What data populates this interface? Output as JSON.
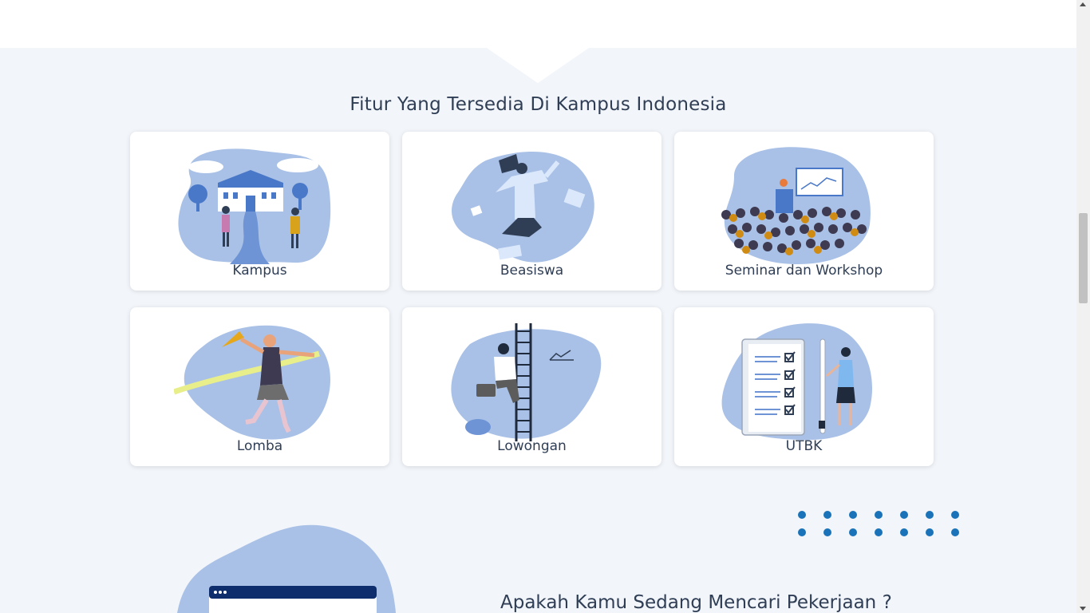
{
  "section": {
    "title": "Fitur Yang Tersedia Di Kampus Indonesia"
  },
  "features": [
    {
      "label": "Kampus",
      "icon": "campus-illustration"
    },
    {
      "label": "Beasiswa",
      "icon": "scholarship-illustration"
    },
    {
      "label": "Seminar dan Workshop",
      "icon": "seminar-illustration"
    },
    {
      "label": "Lomba",
      "icon": "competition-illustration"
    },
    {
      "label": "Lowongan",
      "icon": "job-vacancy-illustration"
    },
    {
      "label": "UTBK",
      "icon": "exam-checklist-illustration"
    }
  ],
  "next_section": {
    "heading": "Apakah Kamu Sedang Mencari Pekerjaan ?"
  },
  "colors": {
    "section_bg": "#f2f5fa",
    "blob": "#a9c1e6",
    "accent_dots": "#1a73b8",
    "text": "#2f3e55"
  }
}
